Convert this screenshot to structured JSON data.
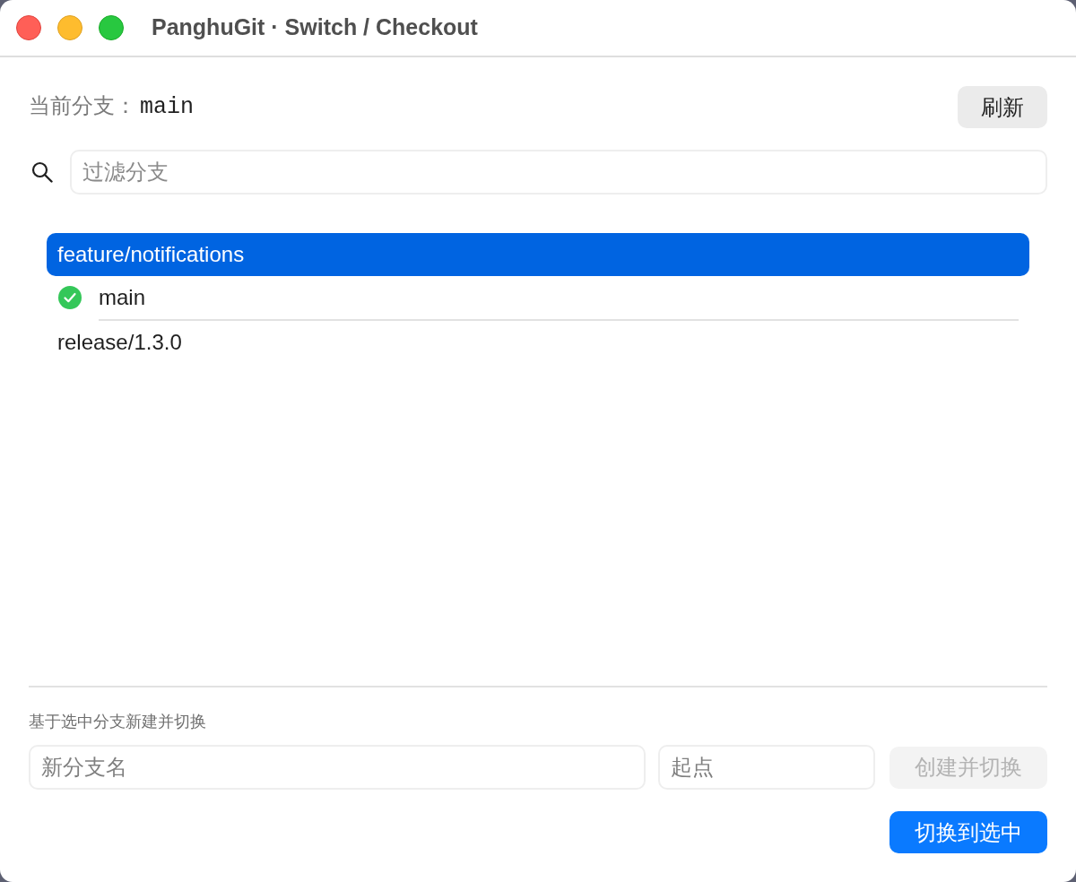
{
  "window": {
    "title": "PanghuGit · Switch / Checkout"
  },
  "current_branch": {
    "label": "当前分支：",
    "value": "main"
  },
  "refresh_button": {
    "label": "刷新"
  },
  "filter": {
    "placeholder": "过滤分支"
  },
  "branches": [
    {
      "name": "feature/notifications",
      "selected": true,
      "current": false
    },
    {
      "name": "main",
      "selected": false,
      "current": true
    },
    {
      "name": "release/1.3.0",
      "selected": false,
      "current": false
    }
  ],
  "create": {
    "label": "基于选中分支新建并切换",
    "name_field": {
      "placeholder": "新分支名"
    },
    "start_field": {
      "placeholder": "起点"
    },
    "button": {
      "label": "创建并切换",
      "disabled": true
    }
  },
  "switch_button": {
    "label": "切换到选中"
  }
}
